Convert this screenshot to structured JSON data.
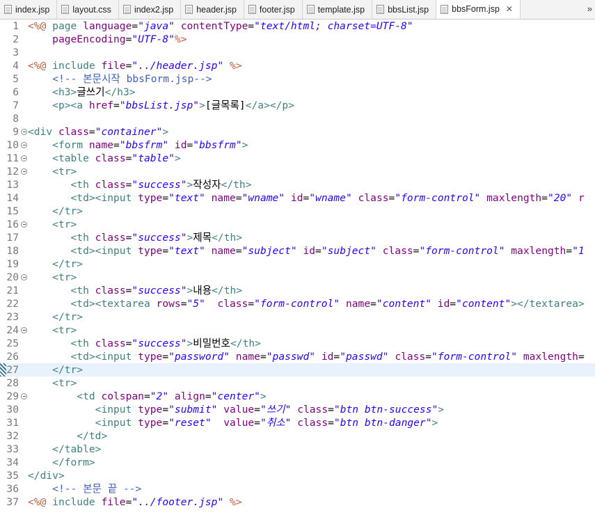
{
  "tabs": [
    {
      "label": "index.jsp",
      "icon": "jsp-file-icon",
      "active": false
    },
    {
      "label": "layout.css",
      "icon": "css-file-icon",
      "active": false
    },
    {
      "label": "index2.jsp",
      "icon": "jsp-file-icon",
      "active": false
    },
    {
      "label": "header.jsp",
      "icon": "jsp-file-icon",
      "active": false
    },
    {
      "label": "footer.jsp",
      "icon": "jsp-file-icon",
      "active": false
    },
    {
      "label": "template.jsp",
      "icon": "jsp-file-icon",
      "active": false
    },
    {
      "label": "bbsList.jsp",
      "icon": "jsp-file-icon",
      "active": false
    },
    {
      "label": "bbsForm.jsp",
      "icon": "jsp-file-icon",
      "active": true
    }
  ],
  "overflow_label": "»",
  "close_label": "✕",
  "current_line": 27,
  "colors": {
    "tag": "#3f7f7f",
    "scriptlet": "#bf5f3f",
    "attribute": "#7f007f",
    "string": "#2a00ff",
    "comment": "#3f5fbf"
  },
  "lines": [
    {
      "n": "1",
      "fold": false,
      "segs": [
        [
          "sc",
          "<%@ "
        ],
        [
          "tg",
          "page "
        ],
        [
          "at",
          "language"
        ],
        [
          "tx",
          "="
        ],
        [
          "st",
          "\"java\""
        ],
        [
          "tx",
          " "
        ],
        [
          "at",
          "contentType"
        ],
        [
          "tx",
          "="
        ],
        [
          "st",
          "\"text/html; charset=UTF-8\""
        ]
      ]
    },
    {
      "n": "2",
      "fold": false,
      "segs": [
        [
          "tx",
          "    "
        ],
        [
          "at",
          "pageEncoding"
        ],
        [
          "tx",
          "="
        ],
        [
          "st",
          "\"UTF-8\""
        ],
        [
          "sc",
          "%>"
        ]
      ]
    },
    {
      "n": "3",
      "fold": false,
      "segs": []
    },
    {
      "n": "4",
      "fold": false,
      "segs": [
        [
          "sc",
          "<%@ "
        ],
        [
          "tg",
          "include "
        ],
        [
          "at",
          "file"
        ],
        [
          "tx",
          "="
        ],
        [
          "st",
          "\"../header.jsp\""
        ],
        [
          "tx",
          " "
        ],
        [
          "sc",
          "%>"
        ]
      ]
    },
    {
      "n": "5",
      "fold": false,
      "segs": [
        [
          "tx",
          "    "
        ],
        [
          "cm",
          "<!-- 본문시작 bbsForm.jsp-->"
        ]
      ]
    },
    {
      "n": "6",
      "fold": false,
      "segs": [
        [
          "tx",
          "    "
        ],
        [
          "tg",
          "<h3>"
        ],
        [
          "tx",
          "글쓰기"
        ],
        [
          "tg",
          "</h3>"
        ]
      ]
    },
    {
      "n": "7",
      "fold": false,
      "segs": [
        [
          "tx",
          "    "
        ],
        [
          "tg",
          "<p><a "
        ],
        [
          "at",
          "href"
        ],
        [
          "tx",
          "="
        ],
        [
          "st",
          "\"bbsList.jsp\""
        ],
        [
          "tg",
          ">"
        ],
        [
          "tx",
          "[글목록]"
        ],
        [
          "tg",
          "</a></p>"
        ]
      ]
    },
    {
      "n": "8",
      "fold": false,
      "segs": []
    },
    {
      "n": "9",
      "fold": true,
      "segs": [
        [
          "tg",
          "<div "
        ],
        [
          "at",
          "class"
        ],
        [
          "tx",
          "="
        ],
        [
          "st",
          "\"container\""
        ],
        [
          "tg",
          ">"
        ]
      ]
    },
    {
      "n": "10",
      "fold": true,
      "segs": [
        [
          "tx",
          "    "
        ],
        [
          "tg",
          "<form "
        ],
        [
          "at",
          "name"
        ],
        [
          "tx",
          "="
        ],
        [
          "st",
          "\"bbsfrm\""
        ],
        [
          "tx",
          " "
        ],
        [
          "at",
          "id"
        ],
        [
          "tx",
          "="
        ],
        [
          "st",
          "\"bbsfrm\""
        ],
        [
          "tg",
          ">"
        ]
      ]
    },
    {
      "n": "11",
      "fold": true,
      "segs": [
        [
          "tx",
          "    "
        ],
        [
          "tg",
          "<table "
        ],
        [
          "at",
          "class"
        ],
        [
          "tx",
          "="
        ],
        [
          "st",
          "\"table\""
        ],
        [
          "tg",
          ">"
        ]
      ]
    },
    {
      "n": "12",
      "fold": true,
      "segs": [
        [
          "tx",
          "    "
        ],
        [
          "tg",
          "<tr>"
        ]
      ]
    },
    {
      "n": "13",
      "fold": false,
      "segs": [
        [
          "tx",
          "       "
        ],
        [
          "tg",
          "<th "
        ],
        [
          "at",
          "class"
        ],
        [
          "tx",
          "="
        ],
        [
          "st",
          "\"success\""
        ],
        [
          "tg",
          ">"
        ],
        [
          "tx",
          "작성자"
        ],
        [
          "tg",
          "</th>"
        ]
      ]
    },
    {
      "n": "14",
      "fold": false,
      "segs": [
        [
          "tx",
          "       "
        ],
        [
          "tg",
          "<td><input "
        ],
        [
          "at",
          "type"
        ],
        [
          "tx",
          "="
        ],
        [
          "st",
          "\"text\""
        ],
        [
          "tx",
          " "
        ],
        [
          "at",
          "name"
        ],
        [
          "tx",
          "="
        ],
        [
          "st",
          "\"wname\""
        ],
        [
          "tx",
          " "
        ],
        [
          "at",
          "id"
        ],
        [
          "tx",
          "="
        ],
        [
          "st",
          "\"wname\""
        ],
        [
          "tx",
          " "
        ],
        [
          "at",
          "class"
        ],
        [
          "tx",
          "="
        ],
        [
          "st",
          "\"form-control\""
        ],
        [
          "tx",
          " "
        ],
        [
          "at",
          "maxlength"
        ],
        [
          "tx",
          "="
        ],
        [
          "st",
          "\"20\""
        ],
        [
          "tx",
          " "
        ],
        [
          "at",
          "r"
        ]
      ]
    },
    {
      "n": "15",
      "fold": false,
      "segs": [
        [
          "tx",
          "    "
        ],
        [
          "tg",
          "</tr>"
        ]
      ]
    },
    {
      "n": "16",
      "fold": true,
      "segs": [
        [
          "tx",
          "    "
        ],
        [
          "tg",
          "<tr>"
        ]
      ]
    },
    {
      "n": "17",
      "fold": false,
      "segs": [
        [
          "tx",
          "       "
        ],
        [
          "tg",
          "<th "
        ],
        [
          "at",
          "class"
        ],
        [
          "tx",
          "="
        ],
        [
          "st",
          "\"success\""
        ],
        [
          "tg",
          ">"
        ],
        [
          "tx",
          "제목"
        ],
        [
          "tg",
          "</th>"
        ]
      ]
    },
    {
      "n": "18",
      "fold": false,
      "segs": [
        [
          "tx",
          "       "
        ],
        [
          "tg",
          "<td><input "
        ],
        [
          "at",
          "type"
        ],
        [
          "tx",
          "="
        ],
        [
          "st",
          "\"text\""
        ],
        [
          "tx",
          " "
        ],
        [
          "at",
          "name"
        ],
        [
          "tx",
          "="
        ],
        [
          "st",
          "\"subject\""
        ],
        [
          "tx",
          " "
        ],
        [
          "at",
          "id"
        ],
        [
          "tx",
          "="
        ],
        [
          "st",
          "\"subject\""
        ],
        [
          "tx",
          " "
        ],
        [
          "at",
          "class"
        ],
        [
          "tx",
          "="
        ],
        [
          "st",
          "\"form-control\""
        ],
        [
          "tx",
          " "
        ],
        [
          "at",
          "maxlength"
        ],
        [
          "tx",
          "="
        ],
        [
          "st",
          "\"1"
        ]
      ]
    },
    {
      "n": "19",
      "fold": false,
      "segs": [
        [
          "tx",
          "    "
        ],
        [
          "tg",
          "</tr>"
        ]
      ]
    },
    {
      "n": "20",
      "fold": true,
      "segs": [
        [
          "tx",
          "    "
        ],
        [
          "tg",
          "<tr>"
        ]
      ]
    },
    {
      "n": "21",
      "fold": false,
      "segs": [
        [
          "tx",
          "       "
        ],
        [
          "tg",
          "<th "
        ],
        [
          "at",
          "class"
        ],
        [
          "tx",
          "="
        ],
        [
          "st",
          "\"success\""
        ],
        [
          "tg",
          ">"
        ],
        [
          "tx",
          "내용"
        ],
        [
          "tg",
          "</th>"
        ]
      ]
    },
    {
      "n": "22",
      "fold": false,
      "segs": [
        [
          "tx",
          "       "
        ],
        [
          "tg",
          "<td><textarea "
        ],
        [
          "at",
          "rows"
        ],
        [
          "tx",
          "="
        ],
        [
          "st",
          "\"5\""
        ],
        [
          "tx",
          "  "
        ],
        [
          "at",
          "class"
        ],
        [
          "tx",
          "="
        ],
        [
          "st",
          "\"form-control\""
        ],
        [
          "tx",
          " "
        ],
        [
          "at",
          "name"
        ],
        [
          "tx",
          "="
        ],
        [
          "st",
          "\"content\""
        ],
        [
          "tx",
          " "
        ],
        [
          "at",
          "id"
        ],
        [
          "tx",
          "="
        ],
        [
          "st",
          "\"content\""
        ],
        [
          "tg",
          "></textarea>"
        ]
      ]
    },
    {
      "n": "23",
      "fold": false,
      "segs": [
        [
          "tx",
          "    "
        ],
        [
          "tg",
          "</tr>"
        ]
      ]
    },
    {
      "n": "24",
      "fold": true,
      "segs": [
        [
          "tx",
          "    "
        ],
        [
          "tg",
          "<tr>"
        ]
      ]
    },
    {
      "n": "25",
      "fold": false,
      "segs": [
        [
          "tx",
          "       "
        ],
        [
          "tg",
          "<th "
        ],
        [
          "at",
          "class"
        ],
        [
          "tx",
          "="
        ],
        [
          "st",
          "\"success\""
        ],
        [
          "tg",
          ">"
        ],
        [
          "tx",
          "비밀번호"
        ],
        [
          "tg",
          "</th>"
        ]
      ]
    },
    {
      "n": "26",
      "fold": false,
      "segs": [
        [
          "tx",
          "       "
        ],
        [
          "tg",
          "<td><input "
        ],
        [
          "at",
          "type"
        ],
        [
          "tx",
          "="
        ],
        [
          "st",
          "\"password\""
        ],
        [
          "tx",
          " "
        ],
        [
          "at",
          "name"
        ],
        [
          "tx",
          "="
        ],
        [
          "st",
          "\"passwd\""
        ],
        [
          "tx",
          " "
        ],
        [
          "at",
          "id"
        ],
        [
          "tx",
          "="
        ],
        [
          "st",
          "\"passwd\""
        ],
        [
          "tx",
          " "
        ],
        [
          "at",
          "class"
        ],
        [
          "tx",
          "="
        ],
        [
          "st",
          "\"form-control\""
        ],
        [
          "tx",
          " "
        ],
        [
          "at",
          "maxlength"
        ],
        [
          "tx",
          "="
        ]
      ]
    },
    {
      "n": "27",
      "fold": false,
      "segs": [
        [
          "tx",
          "    "
        ],
        [
          "tg",
          "</tr>"
        ]
      ]
    },
    {
      "n": "28",
      "fold": false,
      "segs": [
        [
          "tx",
          "    "
        ],
        [
          "tg",
          "<tr>"
        ]
      ]
    },
    {
      "n": "29",
      "fold": true,
      "segs": [
        [
          "tx",
          "        "
        ],
        [
          "tg",
          "<td "
        ],
        [
          "at",
          "colspan"
        ],
        [
          "tx",
          "="
        ],
        [
          "st",
          "\"2\""
        ],
        [
          "tx",
          " "
        ],
        [
          "at",
          "align"
        ],
        [
          "tx",
          "="
        ],
        [
          "st",
          "\"center\""
        ],
        [
          "tg",
          ">"
        ]
      ]
    },
    {
      "n": "30",
      "fold": false,
      "segs": [
        [
          "tx",
          "           "
        ],
        [
          "tg",
          "<input "
        ],
        [
          "at",
          "type"
        ],
        [
          "tx",
          "="
        ],
        [
          "st",
          "\"submit\""
        ],
        [
          "tx",
          " "
        ],
        [
          "at",
          "value"
        ],
        [
          "tx",
          "="
        ],
        [
          "st",
          "\"쓰기\""
        ],
        [
          "tx",
          " "
        ],
        [
          "at",
          "class"
        ],
        [
          "tx",
          "="
        ],
        [
          "st",
          "\"btn btn-success\""
        ],
        [
          "tg",
          ">"
        ]
      ]
    },
    {
      "n": "31",
      "fold": false,
      "segs": [
        [
          "tx",
          "           "
        ],
        [
          "tg",
          "<input "
        ],
        [
          "at",
          "type"
        ],
        [
          "tx",
          "="
        ],
        [
          "st",
          "\"reset\""
        ],
        [
          "tx",
          "  "
        ],
        [
          "at",
          "value"
        ],
        [
          "tx",
          "="
        ],
        [
          "st",
          "\"취소\""
        ],
        [
          "tx",
          " "
        ],
        [
          "at",
          "class"
        ],
        [
          "tx",
          "="
        ],
        [
          "st",
          "\"btn btn-danger\""
        ],
        [
          "tg",
          ">"
        ]
      ]
    },
    {
      "n": "32",
      "fold": false,
      "segs": [
        [
          "tx",
          "        "
        ],
        [
          "tg",
          "</td>"
        ]
      ]
    },
    {
      "n": "33",
      "fold": false,
      "segs": [
        [
          "tx",
          "    "
        ],
        [
          "tg",
          "</table>"
        ]
      ]
    },
    {
      "n": "34",
      "fold": false,
      "segs": [
        [
          "tx",
          "    "
        ],
        [
          "tg",
          "</form>"
        ]
      ]
    },
    {
      "n": "35",
      "fold": false,
      "segs": [
        [
          "tg",
          "</div>"
        ]
      ]
    },
    {
      "n": "36",
      "fold": false,
      "segs": [
        [
          "tx",
          "    "
        ],
        [
          "cm",
          "<!-- 본문 끝 -->"
        ]
      ]
    },
    {
      "n": "37",
      "fold": false,
      "segs": [
        [
          "sc",
          "<%@ "
        ],
        [
          "tg",
          "include "
        ],
        [
          "at",
          "file"
        ],
        [
          "tx",
          "="
        ],
        [
          "st",
          "\"../footer.jsp\""
        ],
        [
          "tx",
          " "
        ],
        [
          "sc",
          "%>"
        ]
      ]
    }
  ]
}
